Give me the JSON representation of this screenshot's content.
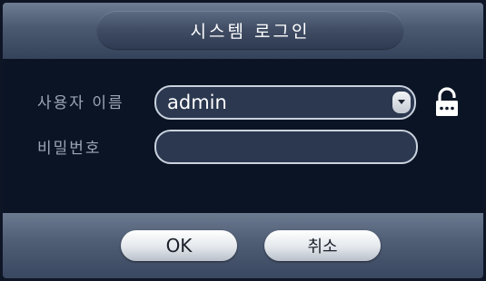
{
  "dialog": {
    "title": "시스템 로그인"
  },
  "form": {
    "username_label": "사용자 이름",
    "username_value": "admin",
    "password_label": "비밀번호",
    "password_value": ""
  },
  "footer": {
    "ok_label": "OK",
    "cancel_label": "취소"
  },
  "icons": {
    "dropdown": "chevron-down-icon",
    "lock": "lock-icon"
  },
  "colors": {
    "title_bar": "#4a5870",
    "body_bg": "#0b1424",
    "field_bg": "#2b3850",
    "field_border": "#c9d2de",
    "label_text": "#9aa6b6"
  }
}
